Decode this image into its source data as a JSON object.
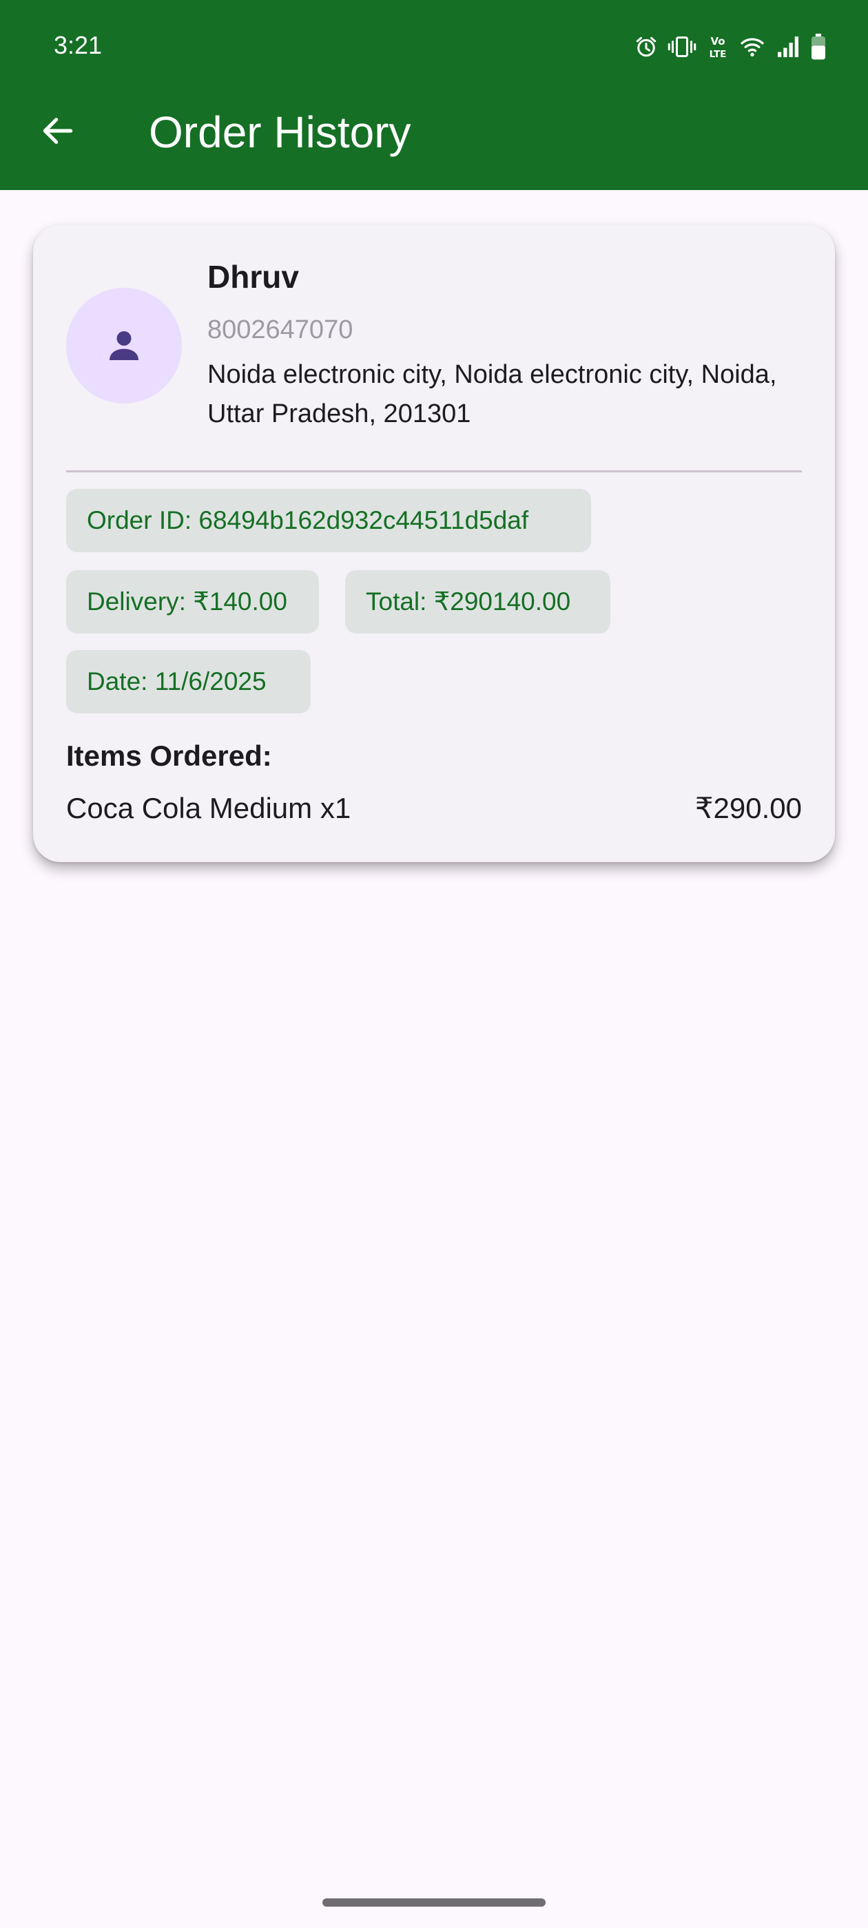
{
  "status_bar": {
    "time": "3:21",
    "icons": [
      "alarm-icon",
      "vibrate-icon",
      "volte-icon",
      "wifi-icon",
      "signal-icon",
      "battery-icon"
    ],
    "volte_text": "Vo LTE"
  },
  "app_bar": {
    "title": "Order History",
    "back_icon": "arrow-back-icon",
    "background_color": "#156F24"
  },
  "order": {
    "customer": {
      "avatar_icon": "person-icon",
      "name": "Dhruv",
      "phone": "8002647070",
      "address": "Noida electronic city, Noida electronic city, Noida, Uttar Pradesh, 201301"
    },
    "order_id": "Order ID: 68494b162d932c44511d5daf",
    "delivery": "Delivery: ₹140.00",
    "total": "Total: ₹290140.00",
    "date": "Date: 11/6/2025",
    "items_heading": "Items Ordered:",
    "items": [
      {
        "name": "Coca Cola Medium x1",
        "price": "₹290.00"
      }
    ]
  },
  "colors": {
    "accent": "#156F24",
    "chip_background": "#DEE3E1",
    "avatar_background": "#EADDFF",
    "avatar_icon": "#4A3A84",
    "page_background": "#FDF7FE",
    "card_background": "#F4F1F7"
  }
}
